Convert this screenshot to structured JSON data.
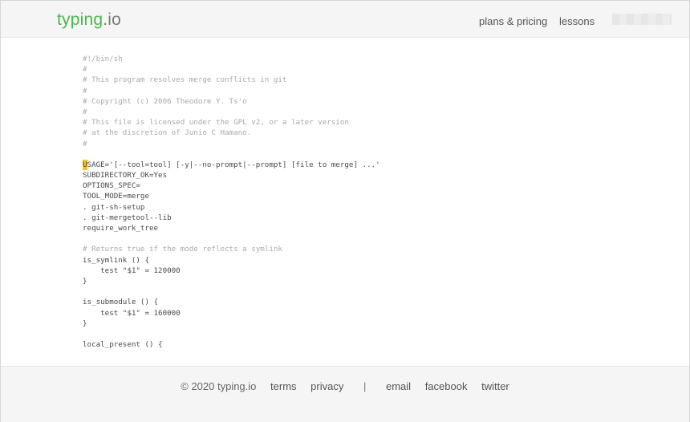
{
  "header": {
    "logo_brand": "typing",
    "logo_tld": ".io",
    "nav": {
      "plans_label": "plans & pricing",
      "lessons_label": "lessons"
    }
  },
  "code": {
    "cursor_char": "U",
    "lines": [
      {
        "text": "#!/bin/sh",
        "kind": "comment"
      },
      {
        "text": "#",
        "kind": "comment"
      },
      {
        "text": "# This program resolves merge conflicts in git",
        "kind": "comment"
      },
      {
        "text": "#",
        "kind": "comment"
      },
      {
        "text": "# Copyright (c) 2006 Theodore Y. Ts'o",
        "kind": "comment"
      },
      {
        "text": "#",
        "kind": "comment"
      },
      {
        "text": "# This file is licensed under the GPL v2, or a later version",
        "kind": "comment"
      },
      {
        "text": "# at the discretion of Junio C Hamano.",
        "kind": "comment"
      },
      {
        "text": "#",
        "kind": "comment"
      },
      {
        "text": "",
        "kind": "blank"
      },
      {
        "text": "SAGE='[--tool=tool] [-y|--no-prompt|--prompt] [file to merge] ...'",
        "kind": "cursor"
      },
      {
        "text": "SUBDIRECTORY_OK=Yes",
        "kind": "code"
      },
      {
        "text": "OPTIONS_SPEC=",
        "kind": "code"
      },
      {
        "text": "TOOL_MODE=merge",
        "kind": "code"
      },
      {
        "text": ". git-sh-setup",
        "kind": "code"
      },
      {
        "text": ". git-mergetool--lib",
        "kind": "code"
      },
      {
        "text": "require_work_tree",
        "kind": "code"
      },
      {
        "text": "",
        "kind": "blank"
      },
      {
        "text": "# Returns true if the mode reflects a symlink",
        "kind": "comment"
      },
      {
        "text": "is_symlink () {",
        "kind": "code"
      },
      {
        "text": "    test \"$1\" = 120000",
        "kind": "code"
      },
      {
        "text": "}",
        "kind": "code"
      },
      {
        "text": "",
        "kind": "blank"
      },
      {
        "text": "is_submodule () {",
        "kind": "code"
      },
      {
        "text": "    test \"$1\" = 160000",
        "kind": "code"
      },
      {
        "text": "}",
        "kind": "code"
      },
      {
        "text": "",
        "kind": "blank"
      },
      {
        "text": "local_present () {",
        "kind": "code"
      }
    ]
  },
  "footer": {
    "copyright": "© 2020 typing.io",
    "terms": "terms",
    "privacy": "privacy",
    "separator": "|",
    "email": "email",
    "facebook": "facebook",
    "twitter": "twitter"
  }
}
